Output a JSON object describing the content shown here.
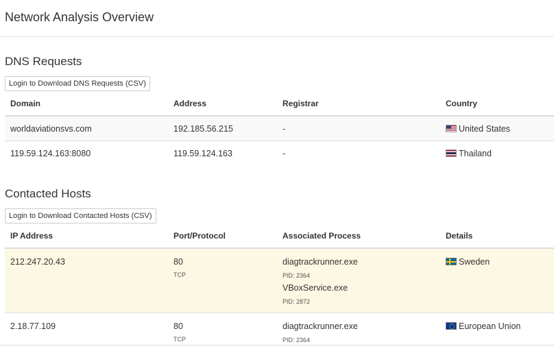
{
  "page": {
    "title": "Network Analysis Overview"
  },
  "dns": {
    "title": "DNS Requests",
    "download_label": "Login to Download DNS Requests (CSV)",
    "columns": [
      "Domain",
      "Address",
      "Registrar",
      "Country"
    ],
    "rows": [
      {
        "domain": "worldaviationsvs.com",
        "address": "192.185.56.215",
        "registrar": "-",
        "country": "United States",
        "flag_icon": "us-flag-icon"
      },
      {
        "domain": "119.59.124.163:8080",
        "address": "119.59.124.163",
        "registrar": "-",
        "country": "Thailand",
        "flag_icon": "thailand-flag-icon"
      }
    ]
  },
  "hosts": {
    "title": "Contacted Hosts",
    "download_label": "Login to Download Contacted Hosts (CSV)",
    "columns": [
      "IP Address",
      "Port/Protocol",
      "Associated Process",
      "Details"
    ],
    "rows": [
      {
        "ip": "212.247.20.43",
        "port": "80",
        "protocol": "TCP",
        "processes": [
          {
            "name": "diagtrackrunner.exe",
            "pid": "PID: 2364"
          },
          {
            "name": "VBoxService.exe",
            "pid": "PID: 2872"
          }
        ],
        "details": "Sweden",
        "flag_icon": "sweden-flag-icon"
      },
      {
        "ip": "2.18.77.109",
        "port": "80",
        "protocol": "TCP",
        "processes": [
          {
            "name": "diagtrackrunner.exe",
            "pid": "PID: 2364"
          }
        ],
        "details": "European Union",
        "flag_icon": "eu-flag-icon"
      }
    ]
  },
  "colors": {
    "highlight_row": "#fcf8e3",
    "striped_row": "#f9f9f9",
    "border": "#dddddd",
    "text": "#333333"
  }
}
